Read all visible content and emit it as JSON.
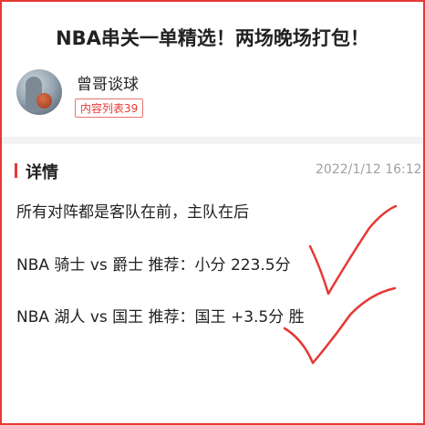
{
  "article": {
    "title": "NBA串关一单精选！两场晚场打包！"
  },
  "author": {
    "name": "曾哥谈球",
    "content_badge": "内容列表39"
  },
  "detail": {
    "heading": "详情",
    "timestamp": "2022/1/12 16:12"
  },
  "body": {
    "note": "所有对阵都是客队在前，主队在后",
    "pick1": "NBA 骑士 vs 爵士 推荐：小分 223.5分",
    "pick2": "NBA 湖人 vs 国王 推荐：国王 +3.5分 胜"
  },
  "colors": {
    "accent": "#e53935",
    "annotation": "#e53935"
  },
  "icons": {
    "checkmarks": "check-mark-icon"
  }
}
